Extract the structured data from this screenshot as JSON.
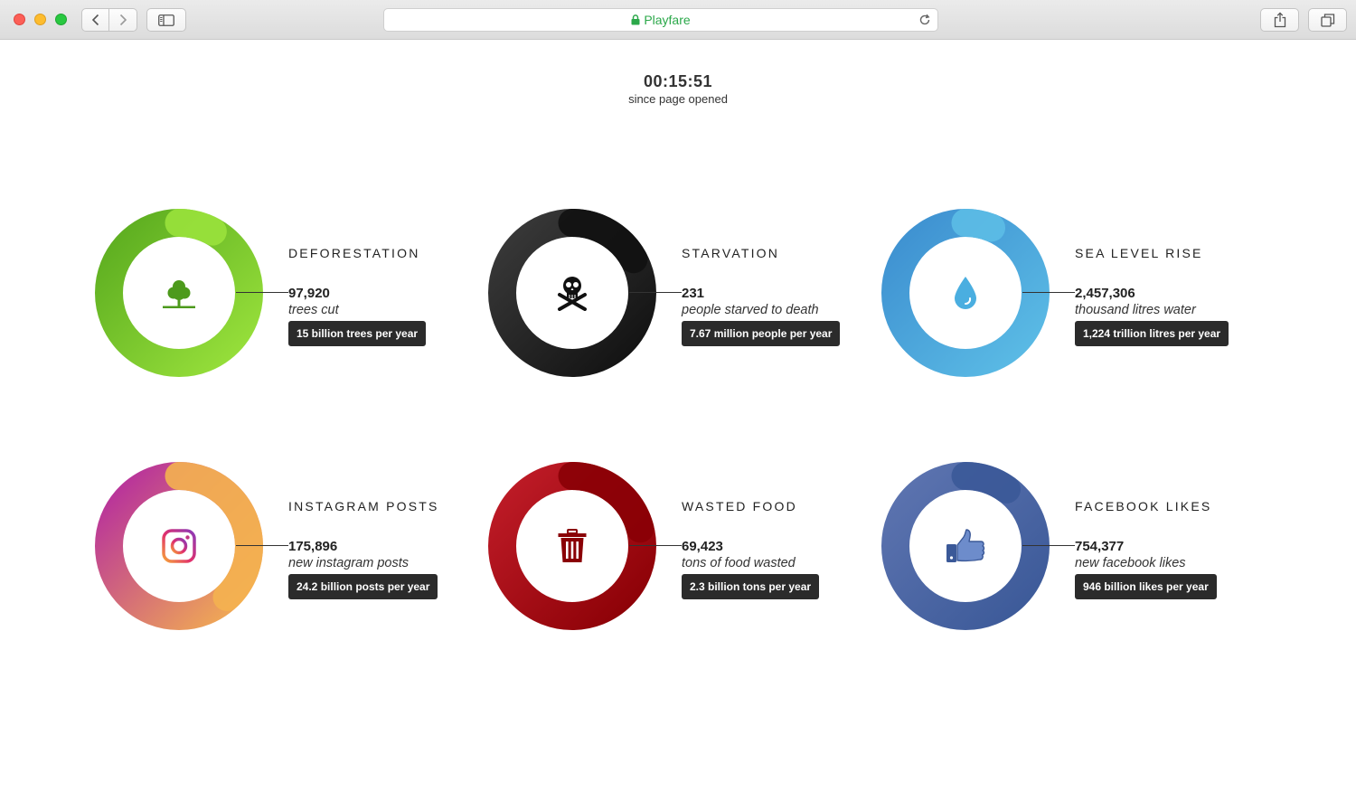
{
  "browser": {
    "address": "Playfare"
  },
  "timer": {
    "time": "00:15:51",
    "caption": "since page opened"
  },
  "stats": [
    {
      "title": "DEFORESTATION",
      "count": "97,920",
      "unit": "trees cut",
      "rate": "15 billion trees per year",
      "icon": "tree-icon",
      "progress": 0.08,
      "colors": [
        "#5aab1f",
        "#9ae23c"
      ]
    },
    {
      "title": "STARVATION",
      "count": "231",
      "unit": "people starved to death",
      "rate": "7.67 million people per year",
      "icon": "skull-crossbones-icon",
      "progress": 0.17,
      "colors": [
        "#3a3a3a",
        "#111111"
      ]
    },
    {
      "title": "SEA LEVEL RISE",
      "count": "2,457,306",
      "unit": "thousand litres water",
      "rate": "1,224 trillion litres per year",
      "icon": "water-drop-icon",
      "progress": 0.06,
      "colors": [
        "#3d8fd0",
        "#5cbde6"
      ]
    },
    {
      "title": "INSTAGRAM POSTS",
      "count": "175,896",
      "unit": "new instagram posts",
      "rate": "24.2 billion posts per year",
      "icon": "instagram-icon",
      "progress": 0.38,
      "colors": [
        "#b42aa0",
        "#f4b150"
      ]
    },
    {
      "title": "WASTED FOOD",
      "count": "69,423",
      "unit": "tons of food wasted",
      "rate": "2.3 billion tons per year",
      "icon": "trash-can-icon",
      "progress": 0.21,
      "colors": [
        "#c01c28",
        "#8a0005"
      ]
    },
    {
      "title": "FACEBOOK LIKES",
      "count": "754,377",
      "unit": "new facebook likes",
      "rate": "946 billion likes per year",
      "icon": "thumbs-up-icon",
      "progress": 0.1,
      "colors": [
        "#5d74b0",
        "#3b5998"
      ]
    }
  ]
}
